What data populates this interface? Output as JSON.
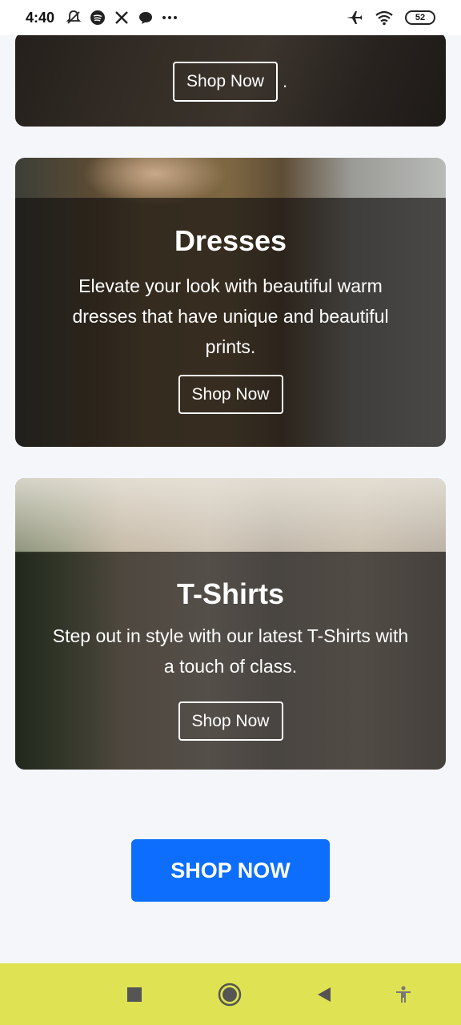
{
  "status": {
    "time": "4:40",
    "battery": "52",
    "icons": [
      "notifications-off-icon",
      "spotify-icon",
      "x-icon",
      "chat-bubble-icon",
      "more-icon",
      "airplane-icon",
      "wifi-icon",
      "battery-icon"
    ]
  },
  "cards": [
    {
      "button": "Shop Now",
      "trailing": "."
    },
    {
      "title": "Dresses",
      "description": "Elevate your look with beautiful warm dresses that have unique and beautiful prints.",
      "button": "Shop Now"
    },
    {
      "title": "T-Shirts",
      "description": "Step out in style with our latest T-Shirts with a touch of class.",
      "button": "Shop Now"
    }
  ],
  "cta": {
    "label": "SHOP NOW",
    "color": "#0d6efd"
  },
  "nav": {
    "color": "#dfe252",
    "items": [
      "recents-square-icon",
      "home-circle-icon",
      "back-triangle-icon",
      "accessibility-icon"
    ]
  }
}
